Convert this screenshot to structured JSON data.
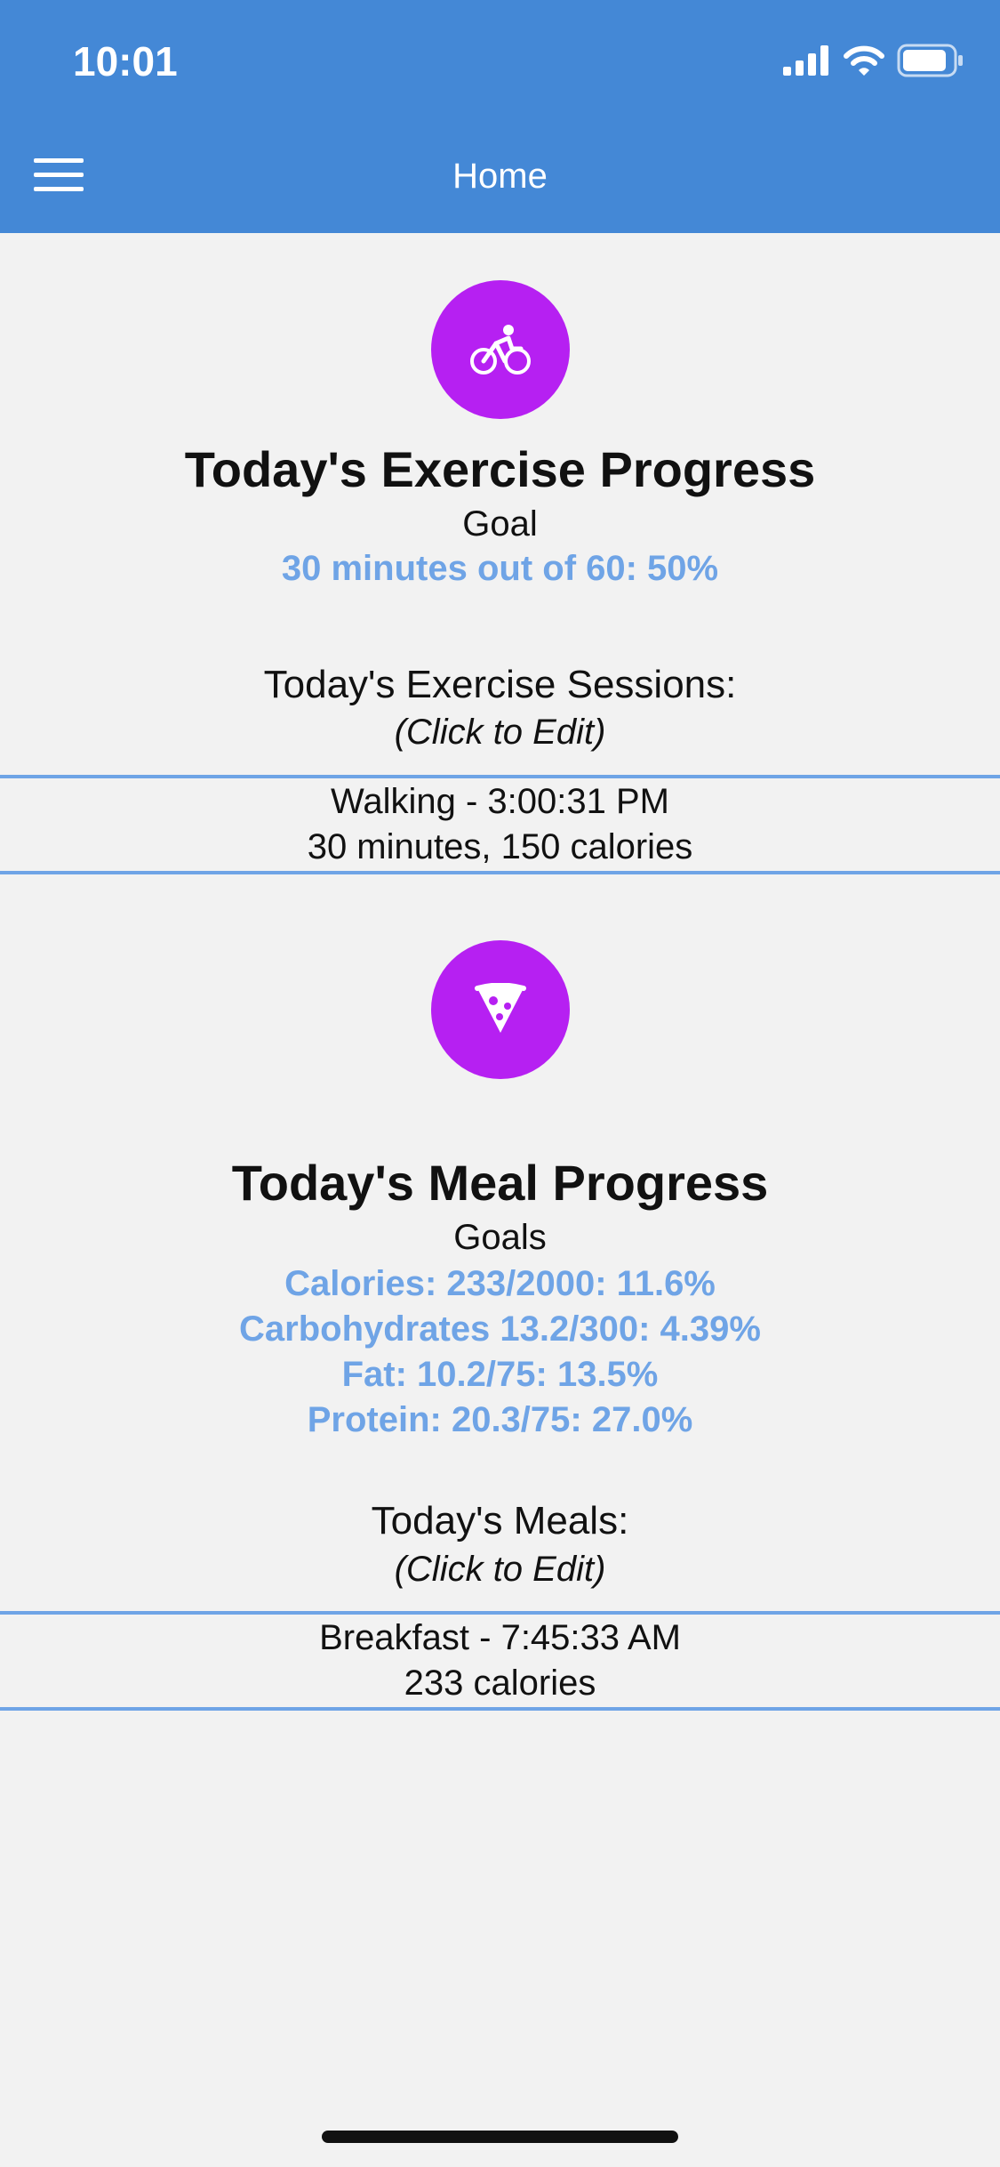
{
  "status_bar": {
    "time": "10:01"
  },
  "header": {
    "title": "Home"
  },
  "exercise": {
    "title": "Today's Exercise Progress",
    "goal_label": "Goal",
    "progress_text": "30 minutes out of 60: 50%",
    "sessions_title": "Today's Exercise Sessions:",
    "edit_hint": "(Click to Edit)",
    "sessions": [
      {
        "title": "Walking - 3:00:31 PM",
        "detail": "30 minutes, 150 calories"
      }
    ]
  },
  "meal": {
    "title": "Today's Meal Progress",
    "goals_label": "Goals",
    "stats": [
      "Calories: 233/2000: 11.6%",
      "Carbohydrates 13.2/300: 4.39%",
      "Fat: 10.2/75: 13.5%",
      "Protein: 20.3/75: 27.0%"
    ],
    "meals_title": "Today's Meals:",
    "edit_hint": "(Click to Edit)",
    "meals": [
      {
        "title": "Breakfast - 7:45:33 AM",
        "detail": "233 calories"
      }
    ]
  },
  "colors": {
    "header_bg": "#4488d6",
    "icon_circle": "#b620f2",
    "accent_text": "#6fa4e6",
    "background": "#f2f2f2"
  }
}
